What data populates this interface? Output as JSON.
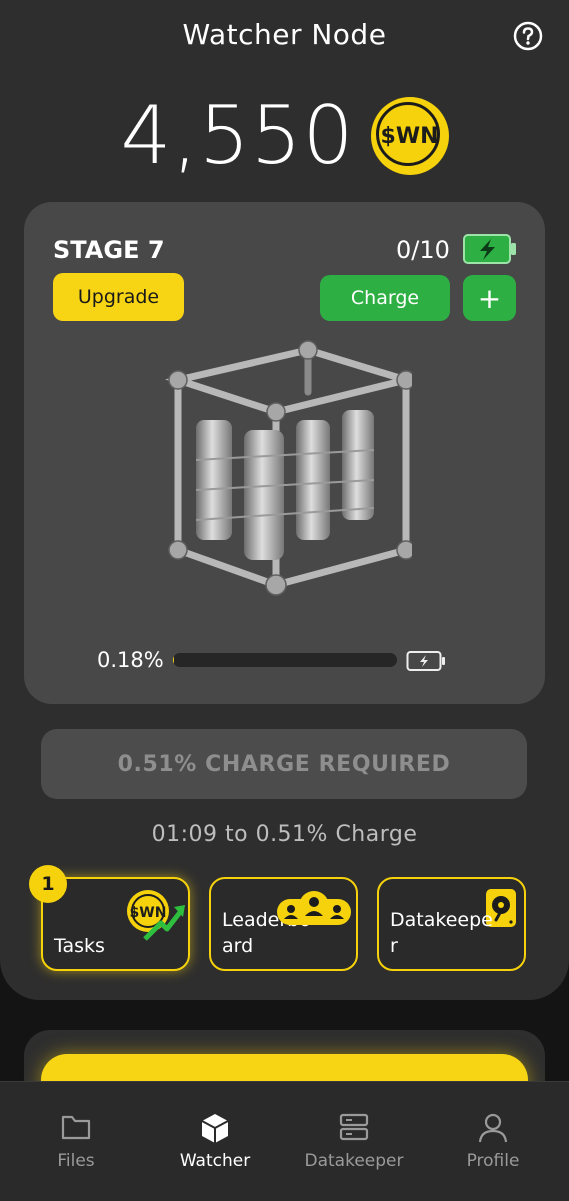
{
  "header": {
    "title": "Watcher Node",
    "help_icon": "question-circle-icon"
  },
  "balance": {
    "value": "4,550",
    "coin_label": "$WN",
    "coin_color": "#f5d20c"
  },
  "stage_card": {
    "stage_label": "STAGE 7",
    "slots": "0/10",
    "battery_icon": "battery-charging-icon",
    "upgrade_label": "Upgrade",
    "charge_label": "Charge",
    "plus_label": "+",
    "image": "watcher-node-cube-machine",
    "progress_label": "0.18%",
    "progress_fraction": 0.0018
  },
  "charge_required_label": "0.51% CHARGE REQUIRED",
  "timer_label": "01:09 to 0.51% Charge",
  "tiles": [
    {
      "label": "Tasks",
      "icon": "wn-coin-up-arrow-icon",
      "badge": "1"
    },
    {
      "label": "Leaderboard",
      "icon": "group-users-icon"
    },
    {
      "label": "Datakeeper",
      "icon": "hard-drive-icon"
    }
  ],
  "nav": [
    {
      "label": "Files",
      "icon": "folder-icon",
      "active": false
    },
    {
      "label": "Watcher",
      "icon": "cube-icon",
      "active": true
    },
    {
      "label": "Datakeeper",
      "icon": "server-icon",
      "active": false
    },
    {
      "label": "Profile",
      "icon": "user-icon",
      "active": false
    }
  ],
  "colors": {
    "accent_yellow": "#f5d20c",
    "accent_green": "#2eaf44",
    "panel": "#2e2e2e",
    "card": "#484848"
  }
}
